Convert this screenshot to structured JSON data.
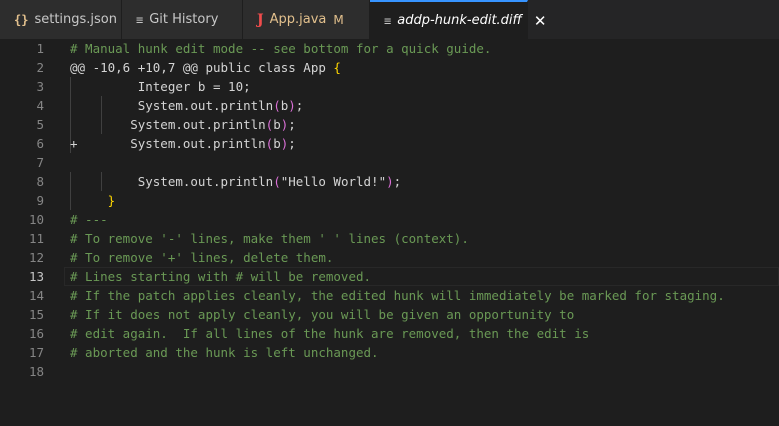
{
  "tabs": [
    {
      "icon": "json-icon",
      "glyph": "{}",
      "label": "settings.json"
    },
    {
      "icon": "git-history-icon",
      "glyph": "≡",
      "label": "Git History"
    },
    {
      "icon": "java-icon",
      "glyph": "J",
      "label": "App.java",
      "modified": "M"
    },
    {
      "icon": "diff-file-icon",
      "glyph": "≡",
      "label": "addp-hunk-edit.diff",
      "close": "✕"
    }
  ],
  "lines": [
    {
      "n": "1",
      "t": [
        {
          "c": "c",
          "s": "# Manual hunk edit mode -- see bottom for a quick guide."
        }
      ]
    },
    {
      "n": "2",
      "t": [
        {
          "s": "@@ -10,6 +10,7 @@ public class App "
        },
        {
          "c": "br1",
          "s": "{"
        }
      ]
    },
    {
      "n": "3",
      "t": [
        {
          "s": "         Integer b = 10;"
        }
      ]
    },
    {
      "n": "4",
      "t": [
        {
          "s": "         System.out.println"
        },
        {
          "c": "br2",
          "s": "("
        },
        {
          "s": "b"
        },
        {
          "c": "br2",
          "s": ")"
        },
        {
          "s": ";"
        }
      ]
    },
    {
      "n": "5",
      "t": [
        {
          "s": "        System.out.println"
        },
        {
          "c": "br2",
          "s": "("
        },
        {
          "s": "b"
        },
        {
          "c": "br2",
          "s": ")"
        },
        {
          "s": ";"
        }
      ]
    },
    {
      "n": "6",
      "t": [
        {
          "s": "+       System.out.println"
        },
        {
          "c": "br2",
          "s": "("
        },
        {
          "s": "b"
        },
        {
          "c": "br2",
          "s": ")"
        },
        {
          "s": ";"
        }
      ]
    },
    {
      "n": "7",
      "t": []
    },
    {
      "n": "8",
      "t": [
        {
          "s": "         System.out.println"
        },
        {
          "c": "br2",
          "s": "("
        },
        {
          "s": "\"Hello World!\""
        },
        {
          "c": "br2",
          "s": ")"
        },
        {
          "s": ";"
        }
      ]
    },
    {
      "n": "9",
      "t": [
        {
          "s": "     "
        },
        {
          "c": "br1",
          "s": "}"
        }
      ]
    },
    {
      "n": "10",
      "t": [
        {
          "c": "c",
          "s": "# ---"
        }
      ]
    },
    {
      "n": "11",
      "t": [
        {
          "c": "c",
          "s": "# To remove '-' lines, make them ' ' lines (context)."
        }
      ]
    },
    {
      "n": "12",
      "t": [
        {
          "c": "c",
          "s": "# To remove '+' lines, delete them."
        }
      ]
    },
    {
      "n": "13",
      "current": true,
      "t": [
        {
          "c": "c",
          "s": "# Lines starting with # will be removed."
        }
      ]
    },
    {
      "n": "14",
      "t": [
        {
          "c": "c",
          "s": "# If the patch applies cleanly, the edited hunk will immediately be marked for staging."
        }
      ]
    },
    {
      "n": "15",
      "t": [
        {
          "c": "c",
          "s": "# If it does not apply cleanly, you will be given an opportunity to"
        }
      ]
    },
    {
      "n": "16",
      "t": [
        {
          "c": "c",
          "s": "# edit again.  If all lines of the hunk are removed, then the edit is"
        }
      ]
    },
    {
      "n": "17",
      "t": [
        {
          "c": "c",
          "s": "# aborted and the hunk is left unchanged."
        }
      ]
    },
    {
      "n": "18",
      "t": []
    }
  ]
}
